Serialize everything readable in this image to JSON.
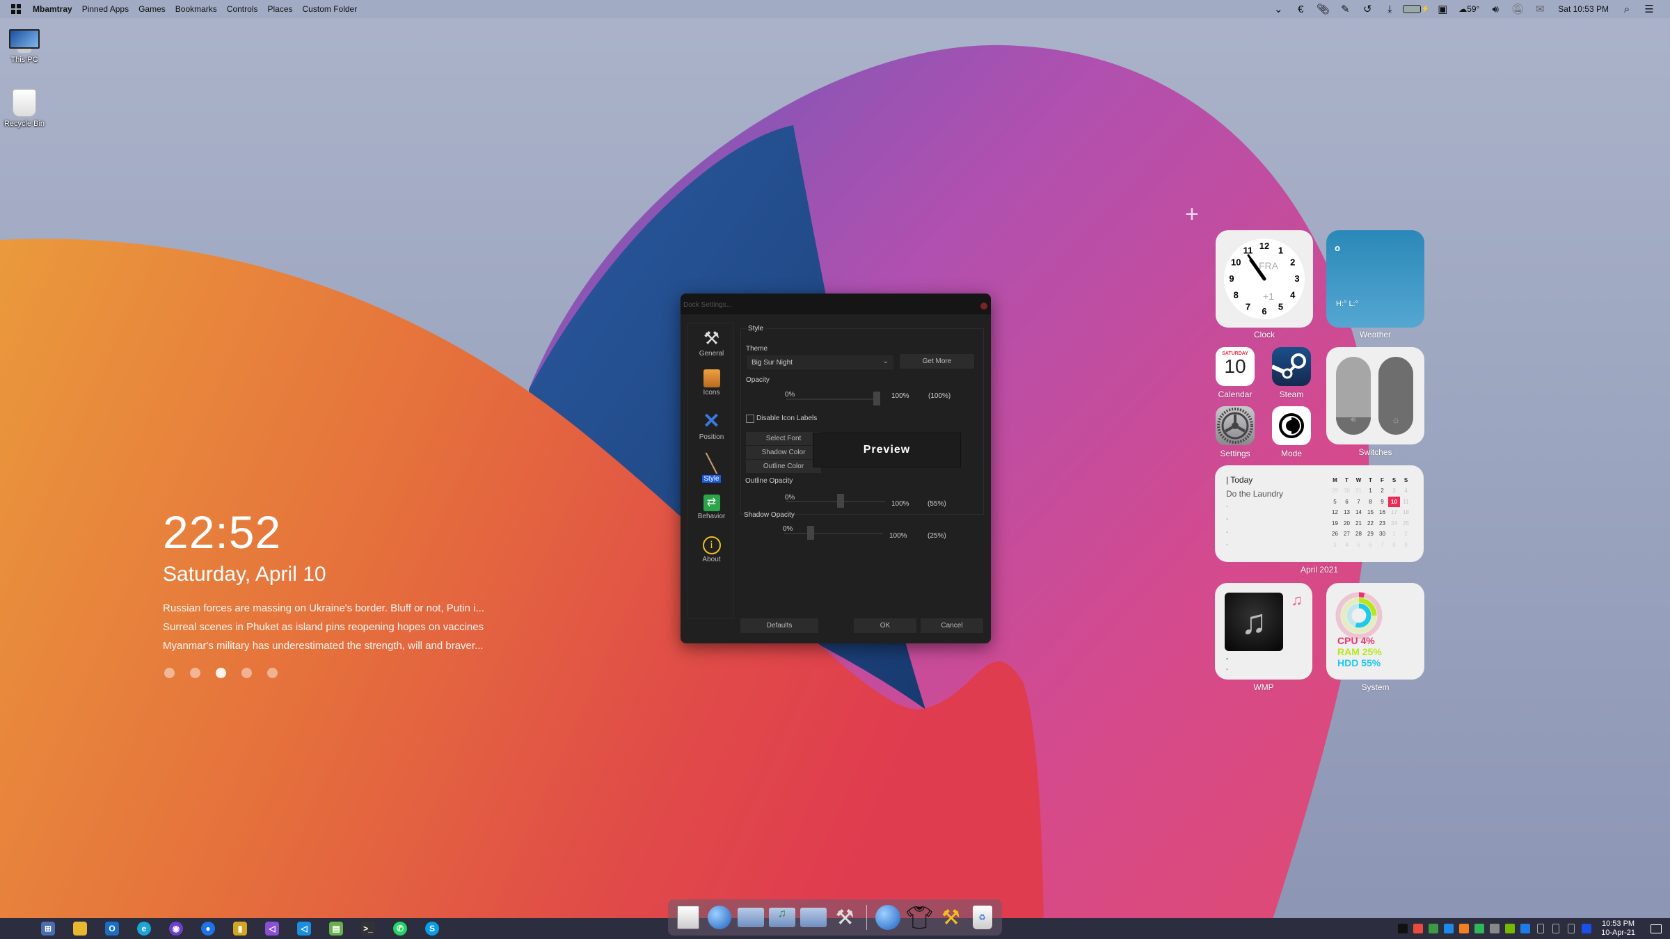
{
  "menubar": {
    "app_name": "Mbamtray",
    "items": [
      "Pinned Apps",
      "Games",
      "Bookmarks",
      "Controls",
      "Places",
      "Custom Folder"
    ],
    "tray": {
      "icons": [
        "chevron-down-icon",
        "euro-icon",
        "paperclip-icon",
        "pencil-icon",
        "history-icon",
        "download-icon",
        "battery-icon",
        "monitor-icon",
        "cloud-icon",
        "volume-icon",
        "notification-muted-icon",
        "mail-icon",
        "search-icon",
        "list-icon"
      ],
      "weather": "59°",
      "datetime": "Sat 10:53 PM"
    }
  },
  "desktop": {
    "icons": [
      {
        "label": "This PC",
        "icon": "computer-icon"
      },
      {
        "label": "Recycle Bin",
        "icon": "recycle-bin-icon"
      }
    ]
  },
  "lockscreen": {
    "time": "22:52",
    "date": "Saturday, April 10",
    "news": [
      "Russian forces are massing on Ukraine's border. Bluff or not, Putin i...",
      "Surreal scenes in Phuket as island pins reopening hopes on vaccines",
      "Myanmar's military has underestimated the strength, will and braver..."
    ],
    "page_count": 5,
    "active_page": 3
  },
  "add_widget_symbol": "+",
  "widgets": {
    "clock": {
      "label": "Clock",
      "numbers": [
        "12",
        "1",
        "2",
        "3",
        "4",
        "5",
        "6",
        "7",
        "8",
        "9",
        "10",
        "11"
      ],
      "city": "FRA",
      "offset": "+1"
    },
    "weather": {
      "label": "Weather",
      "icon": "o",
      "hilo": "H:° L:°"
    },
    "calendar_app": {
      "label": "Calendar",
      "day_name": "SATURDAY",
      "day": "10"
    },
    "steam": {
      "label": "Steam"
    },
    "settings": {
      "label": "Settings"
    },
    "mode": {
      "label": "Mode"
    },
    "switches": {
      "label": "Switches",
      "volume_level": 0.22,
      "brightness_level": 0.0
    },
    "month_calendar": {
      "label": "April 2021",
      "today_header": "| Today",
      "events": [
        "Do the Laundry",
        "-",
        "-",
        "-",
        "-"
      ],
      "weekdays": [
        "M",
        "T",
        "W",
        "T",
        "F",
        "S",
        "S"
      ],
      "weeks": [
        [
          {
            "d": "29",
            "o": true
          },
          {
            "d": "30",
            "o": true
          },
          {
            "d": "31",
            "o": true
          },
          {
            "d": "1"
          },
          {
            "d": "2"
          },
          {
            "d": "3",
            "w": true
          },
          {
            "d": "4",
            "w": true
          }
        ],
        [
          {
            "d": "5"
          },
          {
            "d": "6"
          },
          {
            "d": "7"
          },
          {
            "d": "8"
          },
          {
            "d": "9"
          },
          {
            "d": "10",
            "today": true
          },
          {
            "d": "11",
            "w": true
          }
        ],
        [
          {
            "d": "12"
          },
          {
            "d": "13"
          },
          {
            "d": "14"
          },
          {
            "d": "15"
          },
          {
            "d": "16"
          },
          {
            "d": "17",
            "w": true
          },
          {
            "d": "18",
            "w": true
          }
        ],
        [
          {
            "d": "19"
          },
          {
            "d": "20"
          },
          {
            "d": "21"
          },
          {
            "d": "22"
          },
          {
            "d": "23"
          },
          {
            "d": "24",
            "w": true
          },
          {
            "d": "25",
            "w": true
          }
        ],
        [
          {
            "d": "26"
          },
          {
            "d": "27"
          },
          {
            "d": "28"
          },
          {
            "d": "29"
          },
          {
            "d": "30"
          },
          {
            "d": "1",
            "o": true
          },
          {
            "d": "2",
            "o": true
          }
        ],
        [
          {
            "d": "3",
            "o": true
          },
          {
            "d": "4",
            "o": true
          },
          {
            "d": "5",
            "o": true
          },
          {
            "d": "6",
            "o": true
          },
          {
            "d": "7",
            "o": true
          },
          {
            "d": "8",
            "o": true
          },
          {
            "d": "9",
            "o": true
          }
        ]
      ]
    },
    "wmp": {
      "label": "WMP",
      "line1": "-",
      "line2": "-"
    },
    "system": {
      "label": "System",
      "stats": [
        {
          "name": "CPU",
          "value": "4%",
          "percent": 4,
          "color": "#e8336b"
        },
        {
          "name": "RAM",
          "value": "25%",
          "percent": 25,
          "color": "#b9e61a"
        },
        {
          "name": "HDD",
          "value": "55%",
          "percent": 55,
          "color": "#20c8ea"
        }
      ]
    }
  },
  "dialog": {
    "title": "Dock Settings...",
    "sidebar": [
      {
        "label": "General",
        "icon": "tools-icon"
      },
      {
        "label": "Icons",
        "icon": "box-icon"
      },
      {
        "label": "Position",
        "icon": "arrows-icon"
      },
      {
        "label": "Style",
        "icon": "brush-icon",
        "active": true
      },
      {
        "label": "Behavior",
        "icon": "swap-arrows-icon"
      },
      {
        "label": "About",
        "icon": "info-icon"
      }
    ],
    "group_title": "Style",
    "theme_label": "Theme",
    "theme_value": "Big Sur Night",
    "get_more": "Get More",
    "opacity_label": "Opacity",
    "opacity": {
      "min": "0%",
      "max": "100%",
      "value": "(100%)",
      "percent": 100
    },
    "disable_labels": "Disable Icon Labels",
    "disable_labels_checked": false,
    "select_font": "Select Font",
    "shadow_color": "Shadow Color",
    "outline_color": "Outline Color",
    "preview": "Preview",
    "outline_opacity_label": "Outline Opacity",
    "outline_opacity": {
      "min": "0%",
      "max": "100%",
      "value": "(55%)",
      "percent": 55
    },
    "shadow_opacity_label": "Shadow Opacity",
    "shadow_opacity": {
      "min": "0%",
      "max": "100%",
      "value": "(25%)",
      "percent": 25
    },
    "defaults": "Defaults",
    "ok": "OK",
    "cancel": "Cancel"
  },
  "dock": {
    "items": [
      "system-settings-icon",
      "network-icon",
      "documents-folder-icon",
      "music-folder-icon",
      "pictures-folder-icon",
      "utilities-icon"
    ],
    "items_right": [
      "internet-browser-icon",
      "tshirt-icon",
      "build-tools-icon",
      "trash-icon"
    ]
  },
  "taskbar": {
    "apps": [
      {
        "icon": "windows-start-icon",
        "glyph": "",
        "color": "transparent"
      },
      {
        "icon": "remote-desktop-icon",
        "glyph": "⊞",
        "color": "#4a6fb0"
      },
      {
        "icon": "file-explorer-icon",
        "glyph": "",
        "color": "#e8b830"
      },
      {
        "icon": "outlook-icon",
        "glyph": "O",
        "color": "#1a6fc4"
      },
      {
        "icon": "edge-icon",
        "glyph": "e",
        "color": "#1fa2d6"
      },
      {
        "icon": "github-desktop-icon",
        "glyph": "◉",
        "color": "#6e40c9"
      },
      {
        "icon": "maps-icon",
        "glyph": "●",
        "color": "#1e73e8"
      },
      {
        "icon": "database-tool-icon",
        "glyph": "▮",
        "color": "#d4a520"
      },
      {
        "icon": "visual-studio-icon",
        "glyph": "◁",
        "color": "#8a4fd3"
      },
      {
        "icon": "vscode-icon",
        "glyph": "◁",
        "color": "#1b8fdd"
      },
      {
        "icon": "notepad-icon",
        "glyph": "▤",
        "color": "#6ab04c"
      },
      {
        "icon": "terminal-icon",
        "glyph": ">_",
        "color": "#333"
      },
      {
        "icon": "whatsapp-icon",
        "glyph": "✆",
        "color": "#25d366"
      },
      {
        "icon": "skype-icon",
        "glyph": "S",
        "color": "#0a9de8"
      }
    ],
    "tray_icons": [
      {
        "icon": "black-app-icon",
        "color": "#111"
      },
      {
        "icon": "s-app-icon",
        "color": "#e84c3d"
      },
      {
        "icon": "veeam-icon",
        "color": "#3a9b42"
      },
      {
        "icon": "teamviewer-icon",
        "color": "#1e8ae8"
      },
      {
        "icon": "cloudflare-icon",
        "color": "#f38020"
      },
      {
        "icon": "security-check-icon",
        "color": "#2fb55a"
      },
      {
        "icon": "color-app-icon",
        "color": "#888"
      },
      {
        "icon": "nvidia-icon",
        "color": "#76b900"
      },
      {
        "icon": "bluetooth-icon",
        "color": "#1e7be8"
      },
      {
        "icon": "usb-icon",
        "color": "#aaa"
      },
      {
        "icon": "speaker-icon",
        "color": "#aaa"
      },
      {
        "icon": "network-icon",
        "color": "#aaa"
      },
      {
        "icon": "malwarebytes-icon",
        "color": "#1a4fe8"
      }
    ],
    "time": "10:53 PM",
    "date": "10-Apr-21"
  }
}
